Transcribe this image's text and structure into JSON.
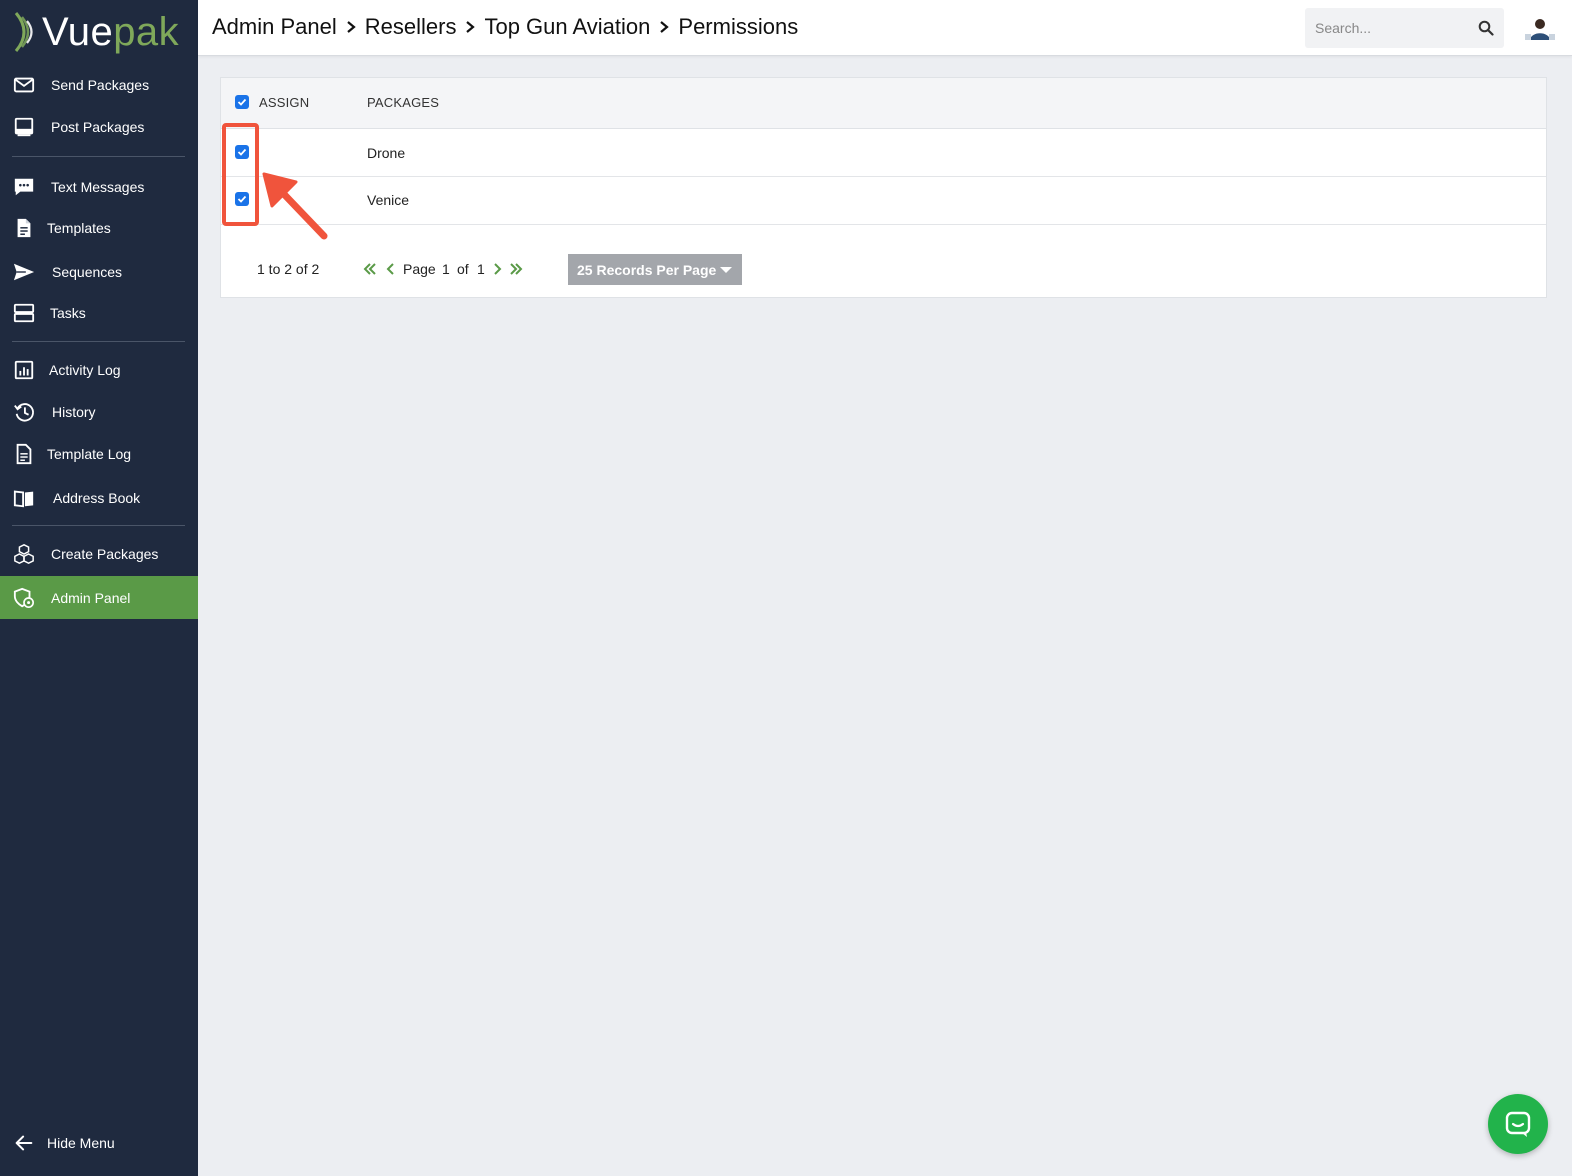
{
  "brand": {
    "name_part1": "Vue",
    "name_part2": "pak",
    "accent": "#7fa85a",
    "sidebar_bg": "#1f2a3f",
    "active_bg": "#5a9a47"
  },
  "sidebar": {
    "items": [
      {
        "label": "Send Packages",
        "icon": "envelope-icon"
      },
      {
        "label": "Post Packages",
        "icon": "monitor-icon"
      },
      {
        "label": "Text Messages",
        "icon": "chat-bubble-icon"
      },
      {
        "label": "Templates",
        "icon": "document-icon"
      },
      {
        "label": "Sequences",
        "icon": "paper-plane-icon"
      },
      {
        "label": "Tasks",
        "icon": "tasks-icon"
      },
      {
        "label": "Activity Log",
        "icon": "bar-chart-icon"
      },
      {
        "label": "History",
        "icon": "history-icon"
      },
      {
        "label": "Template Log",
        "icon": "document-icon"
      },
      {
        "label": "Address Book",
        "icon": "book-icon"
      },
      {
        "label": "Create Packages",
        "icon": "boxes-icon"
      },
      {
        "label": "Admin Panel",
        "icon": "admin-shield-icon",
        "active": true
      }
    ],
    "hide_menu": "Hide Menu"
  },
  "breadcrumb": [
    "Admin Panel",
    "Resellers",
    "Top Gun Aviation",
    "Permissions"
  ],
  "search": {
    "placeholder": "Search..."
  },
  "table": {
    "headers": {
      "assign": "ASSIGN",
      "packages": "PACKAGES"
    },
    "select_all_checked": true,
    "rows": [
      {
        "checked": true,
        "package": "Drone"
      },
      {
        "checked": true,
        "package": "Venice"
      }
    ]
  },
  "pagination": {
    "range": "1 to 2 of 2",
    "page_label": "Page",
    "page": "1",
    "of_label": "of",
    "total_pages": "1",
    "records_per_page": "25 Records Per Page"
  },
  "annotation": {
    "color": "#f0543c"
  },
  "chat": {
    "color": "#22b34b",
    "icon": "chat-icon"
  }
}
